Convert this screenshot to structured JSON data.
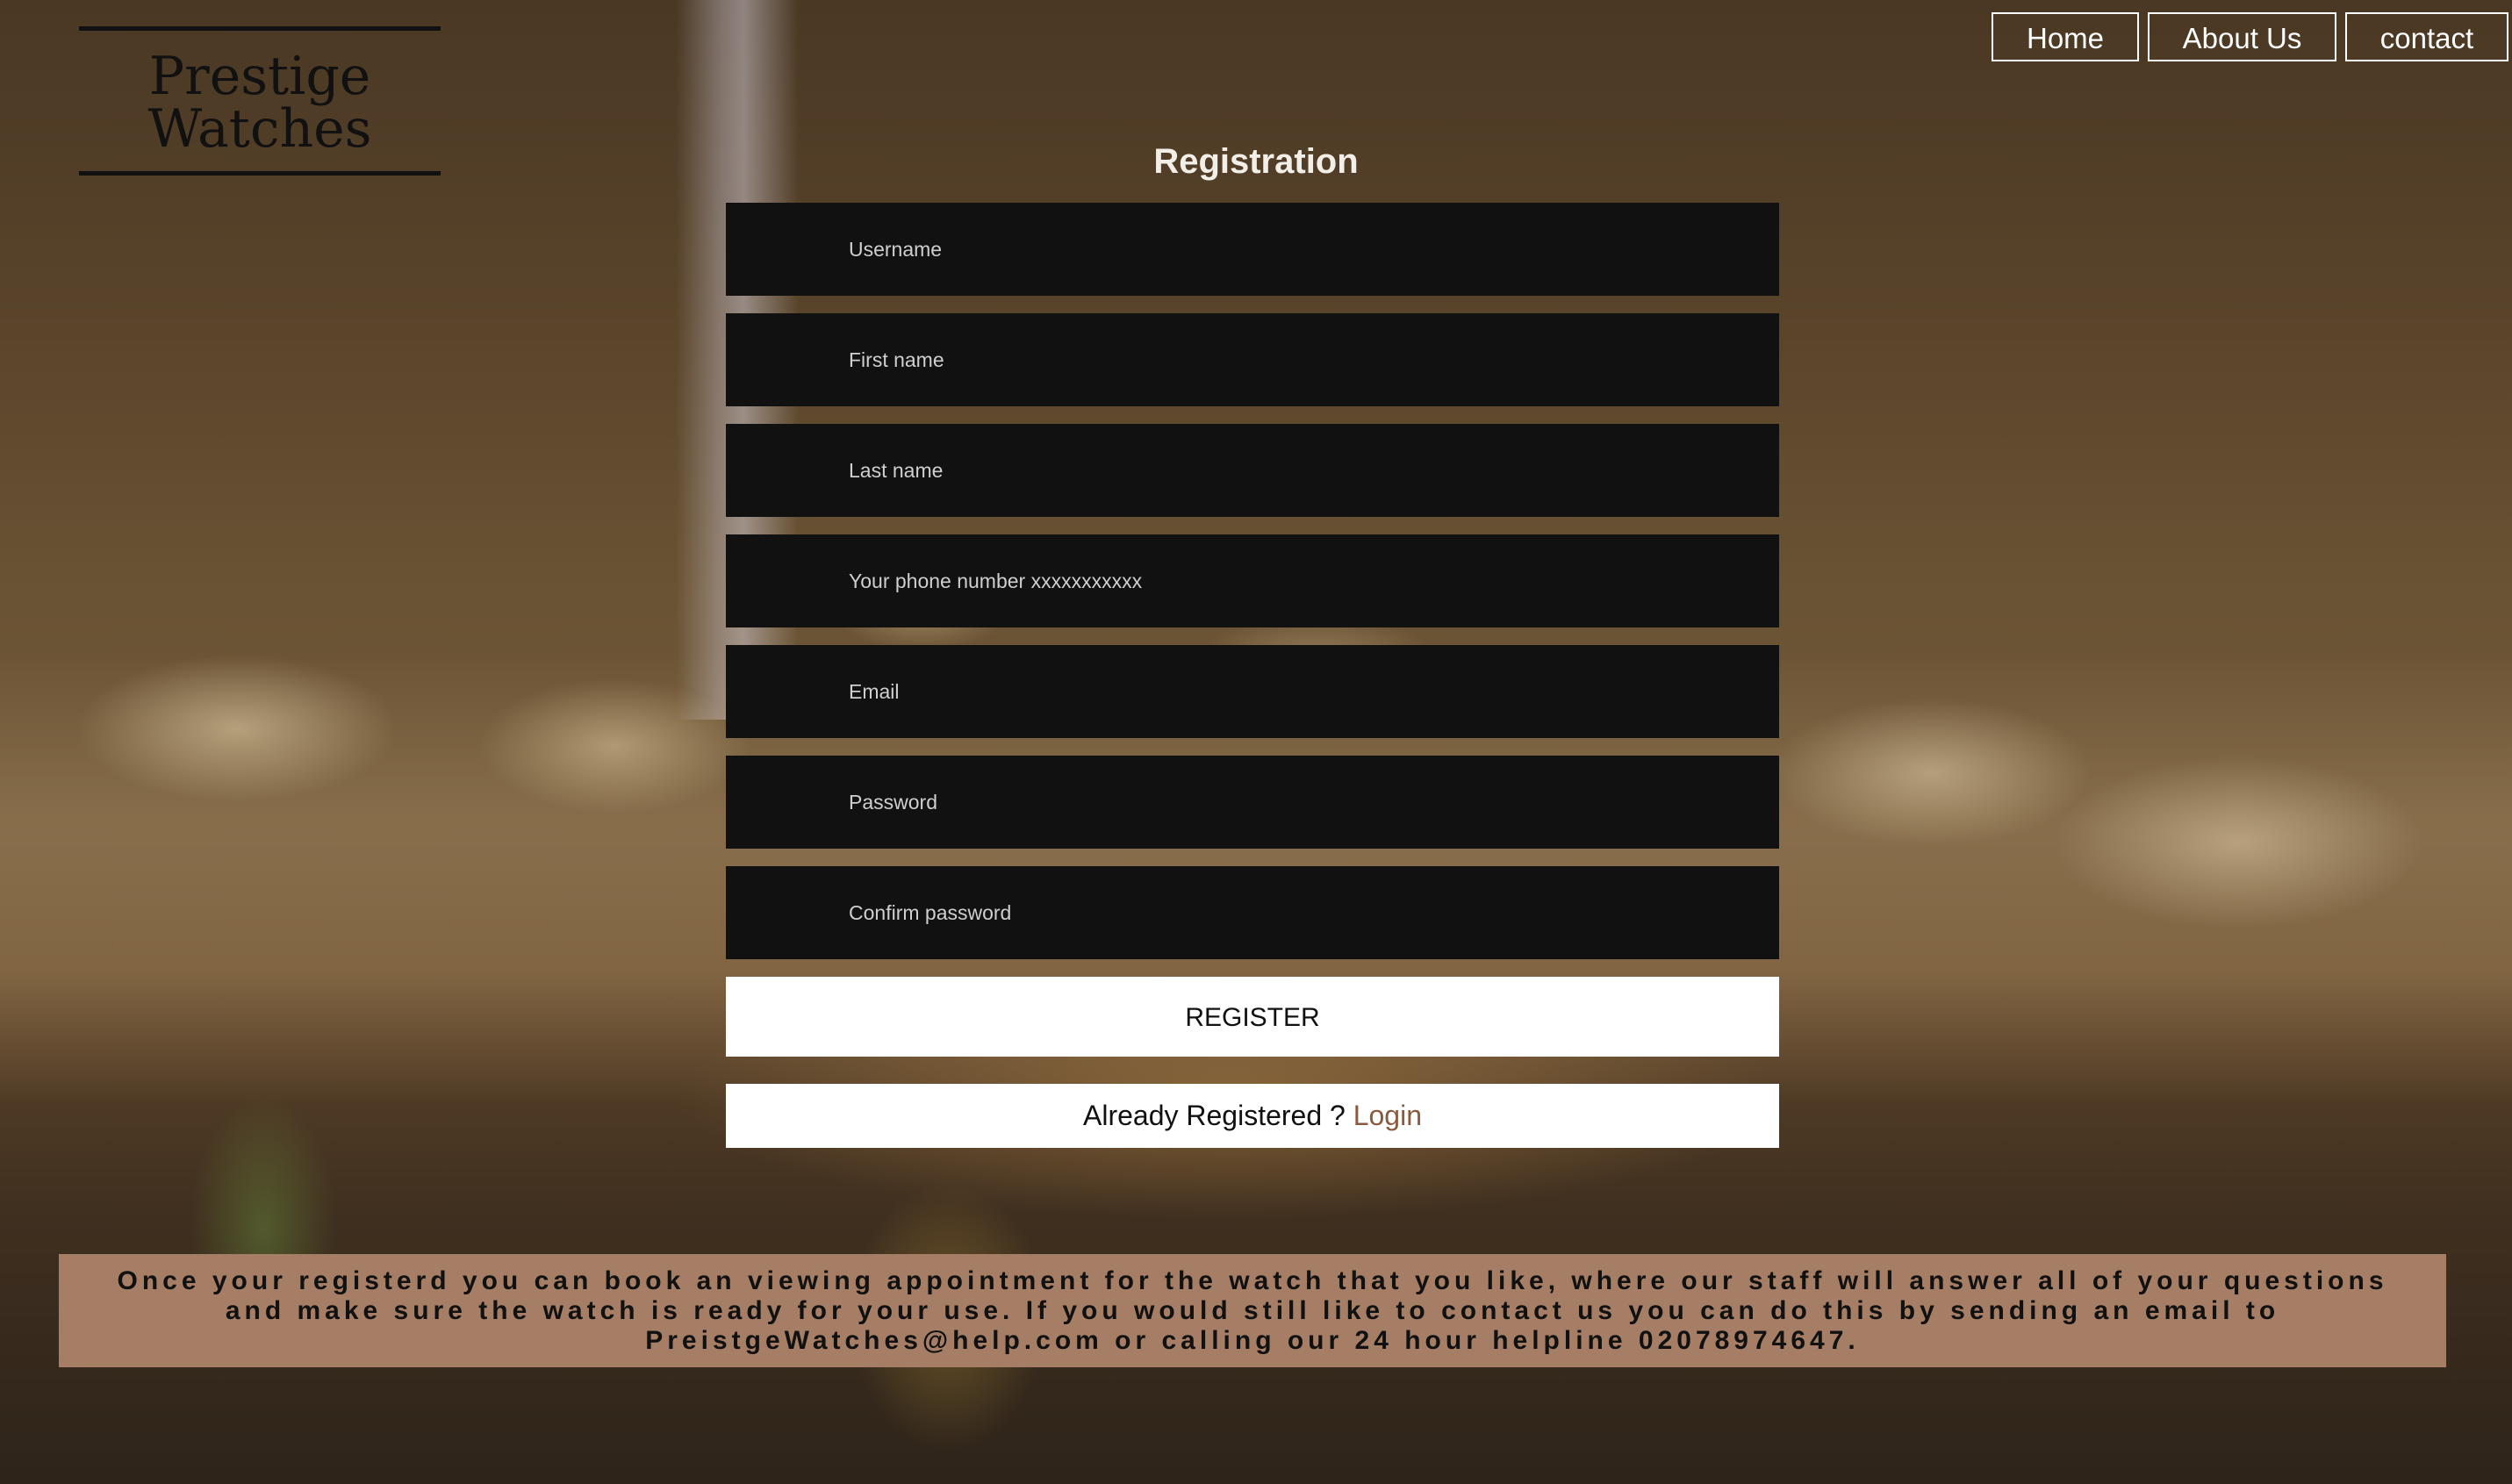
{
  "brand": {
    "name": "Prestige Watches"
  },
  "nav": {
    "home": "Home",
    "about": "About Us",
    "contact": "contact"
  },
  "form": {
    "title": "Registration",
    "fields": {
      "username": {
        "placeholder": "Username",
        "value": ""
      },
      "first_name": {
        "placeholder": "First name",
        "value": ""
      },
      "last_name": {
        "placeholder": "Last name",
        "value": ""
      },
      "phone": {
        "placeholder": "Your phone number xxxxxxxxxxx",
        "value": ""
      },
      "email": {
        "placeholder": "Email",
        "value": ""
      },
      "password": {
        "placeholder": "Password",
        "value": ""
      },
      "confirm_password": {
        "placeholder": "Confirm password",
        "value": ""
      }
    },
    "register_label": "REGISTER",
    "already_registered_text": "Already Registered ?",
    "login_link": "Login"
  },
  "info": {
    "text": "Once your registerd you can book an viewing appointment for the watch that you like, where our staff will answer all of your questions and make sure the watch is ready for your use. If you would still like to contact us you can do this by sending an email to PreistgeWatches@help.com or calling our 24 hour helpline 02078974647."
  },
  "colors": {
    "field_background": "#111111",
    "info_background": "#a67e66",
    "login_link": "#8a5a3e"
  }
}
